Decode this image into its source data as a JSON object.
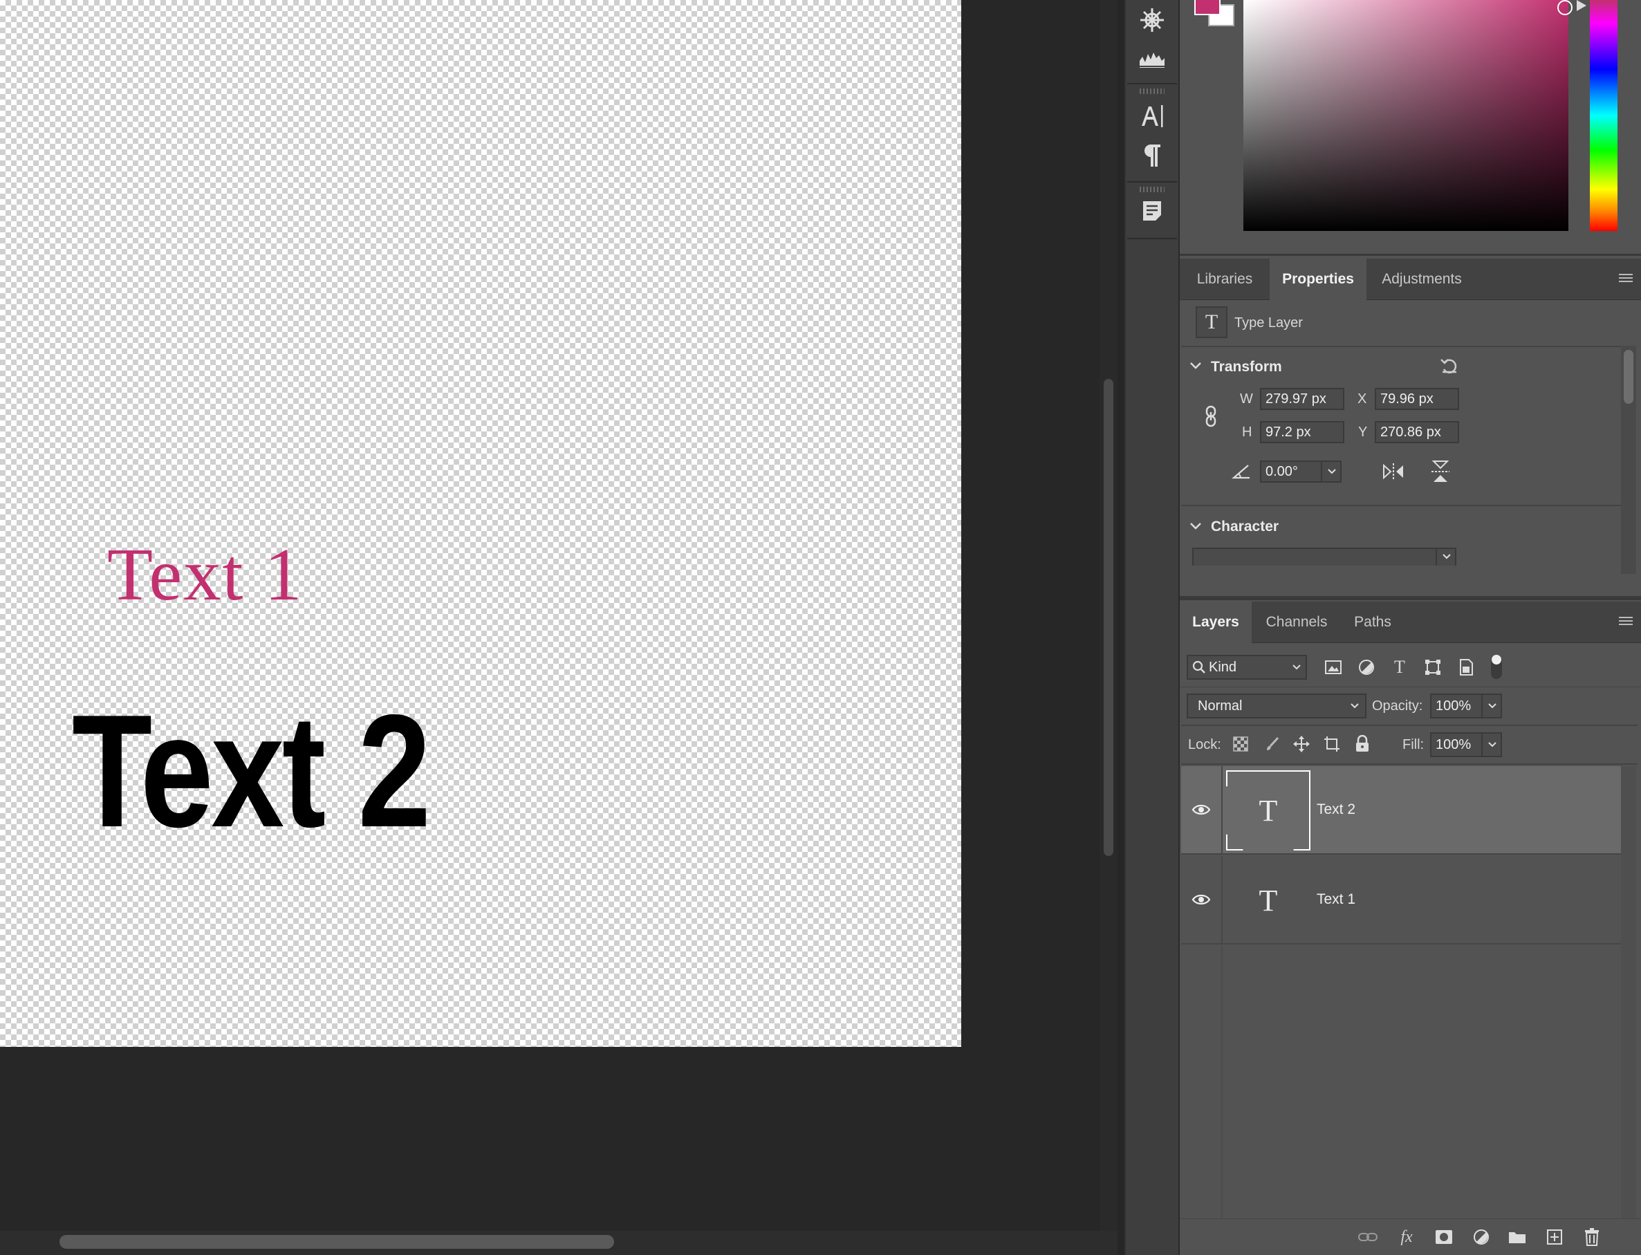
{
  "canvas": {
    "layer_text_1": "Text 1",
    "layer_text_2": "Text 2",
    "text_1_color": "#c2306f",
    "text_2_color": "#000000"
  },
  "color_panel": {
    "foreground": "#c2306f",
    "background": "#ffffff"
  },
  "properties_tabs": [
    "Libraries",
    "Properties",
    "Adjustments"
  ],
  "properties": {
    "layer_kind": "Type Layer",
    "transform_title": "Transform",
    "w_label": "W",
    "w_value": "279.97 px",
    "h_label": "H",
    "h_value": "97.2 px",
    "x_label": "X",
    "x_value": "79.96 px",
    "y_label": "Y",
    "y_value": "270.86 px",
    "angle_value": "0.00°",
    "character_title": "Character"
  },
  "layers_tabs": [
    "Layers",
    "Channels",
    "Paths"
  ],
  "layers_panel": {
    "filter_kind": "Kind",
    "blend_mode": "Normal",
    "opacity_label": "Opacity:",
    "opacity_value": "100%",
    "lock_label": "Lock:",
    "fill_label": "Fill:",
    "fill_value": "100%",
    "layers": [
      {
        "name": "Text 2",
        "selected": true
      },
      {
        "name": "Text 1",
        "selected": false
      }
    ]
  },
  "icons": {
    "strip": [
      "ship-wheel-icon",
      "histogram-icon",
      "character-icon",
      "paragraph-icon",
      "notes-icon"
    ],
    "filter": [
      "pixel-layer-filter-icon",
      "adjustment-filter-icon",
      "type-filter-icon",
      "shape-filter-icon",
      "smart-object-filter-icon",
      "filter-toggle-icon"
    ],
    "lock": [
      "lock-transparent-icon",
      "lock-image-icon",
      "lock-position-icon",
      "lock-artboard-icon",
      "lock-all-icon"
    ],
    "bottom": [
      "link-layers-icon",
      "fx-icon",
      "add-mask-icon",
      "adjustment-layer-icon",
      "new-group-icon",
      "new-layer-icon",
      "delete-layer-icon"
    ]
  }
}
